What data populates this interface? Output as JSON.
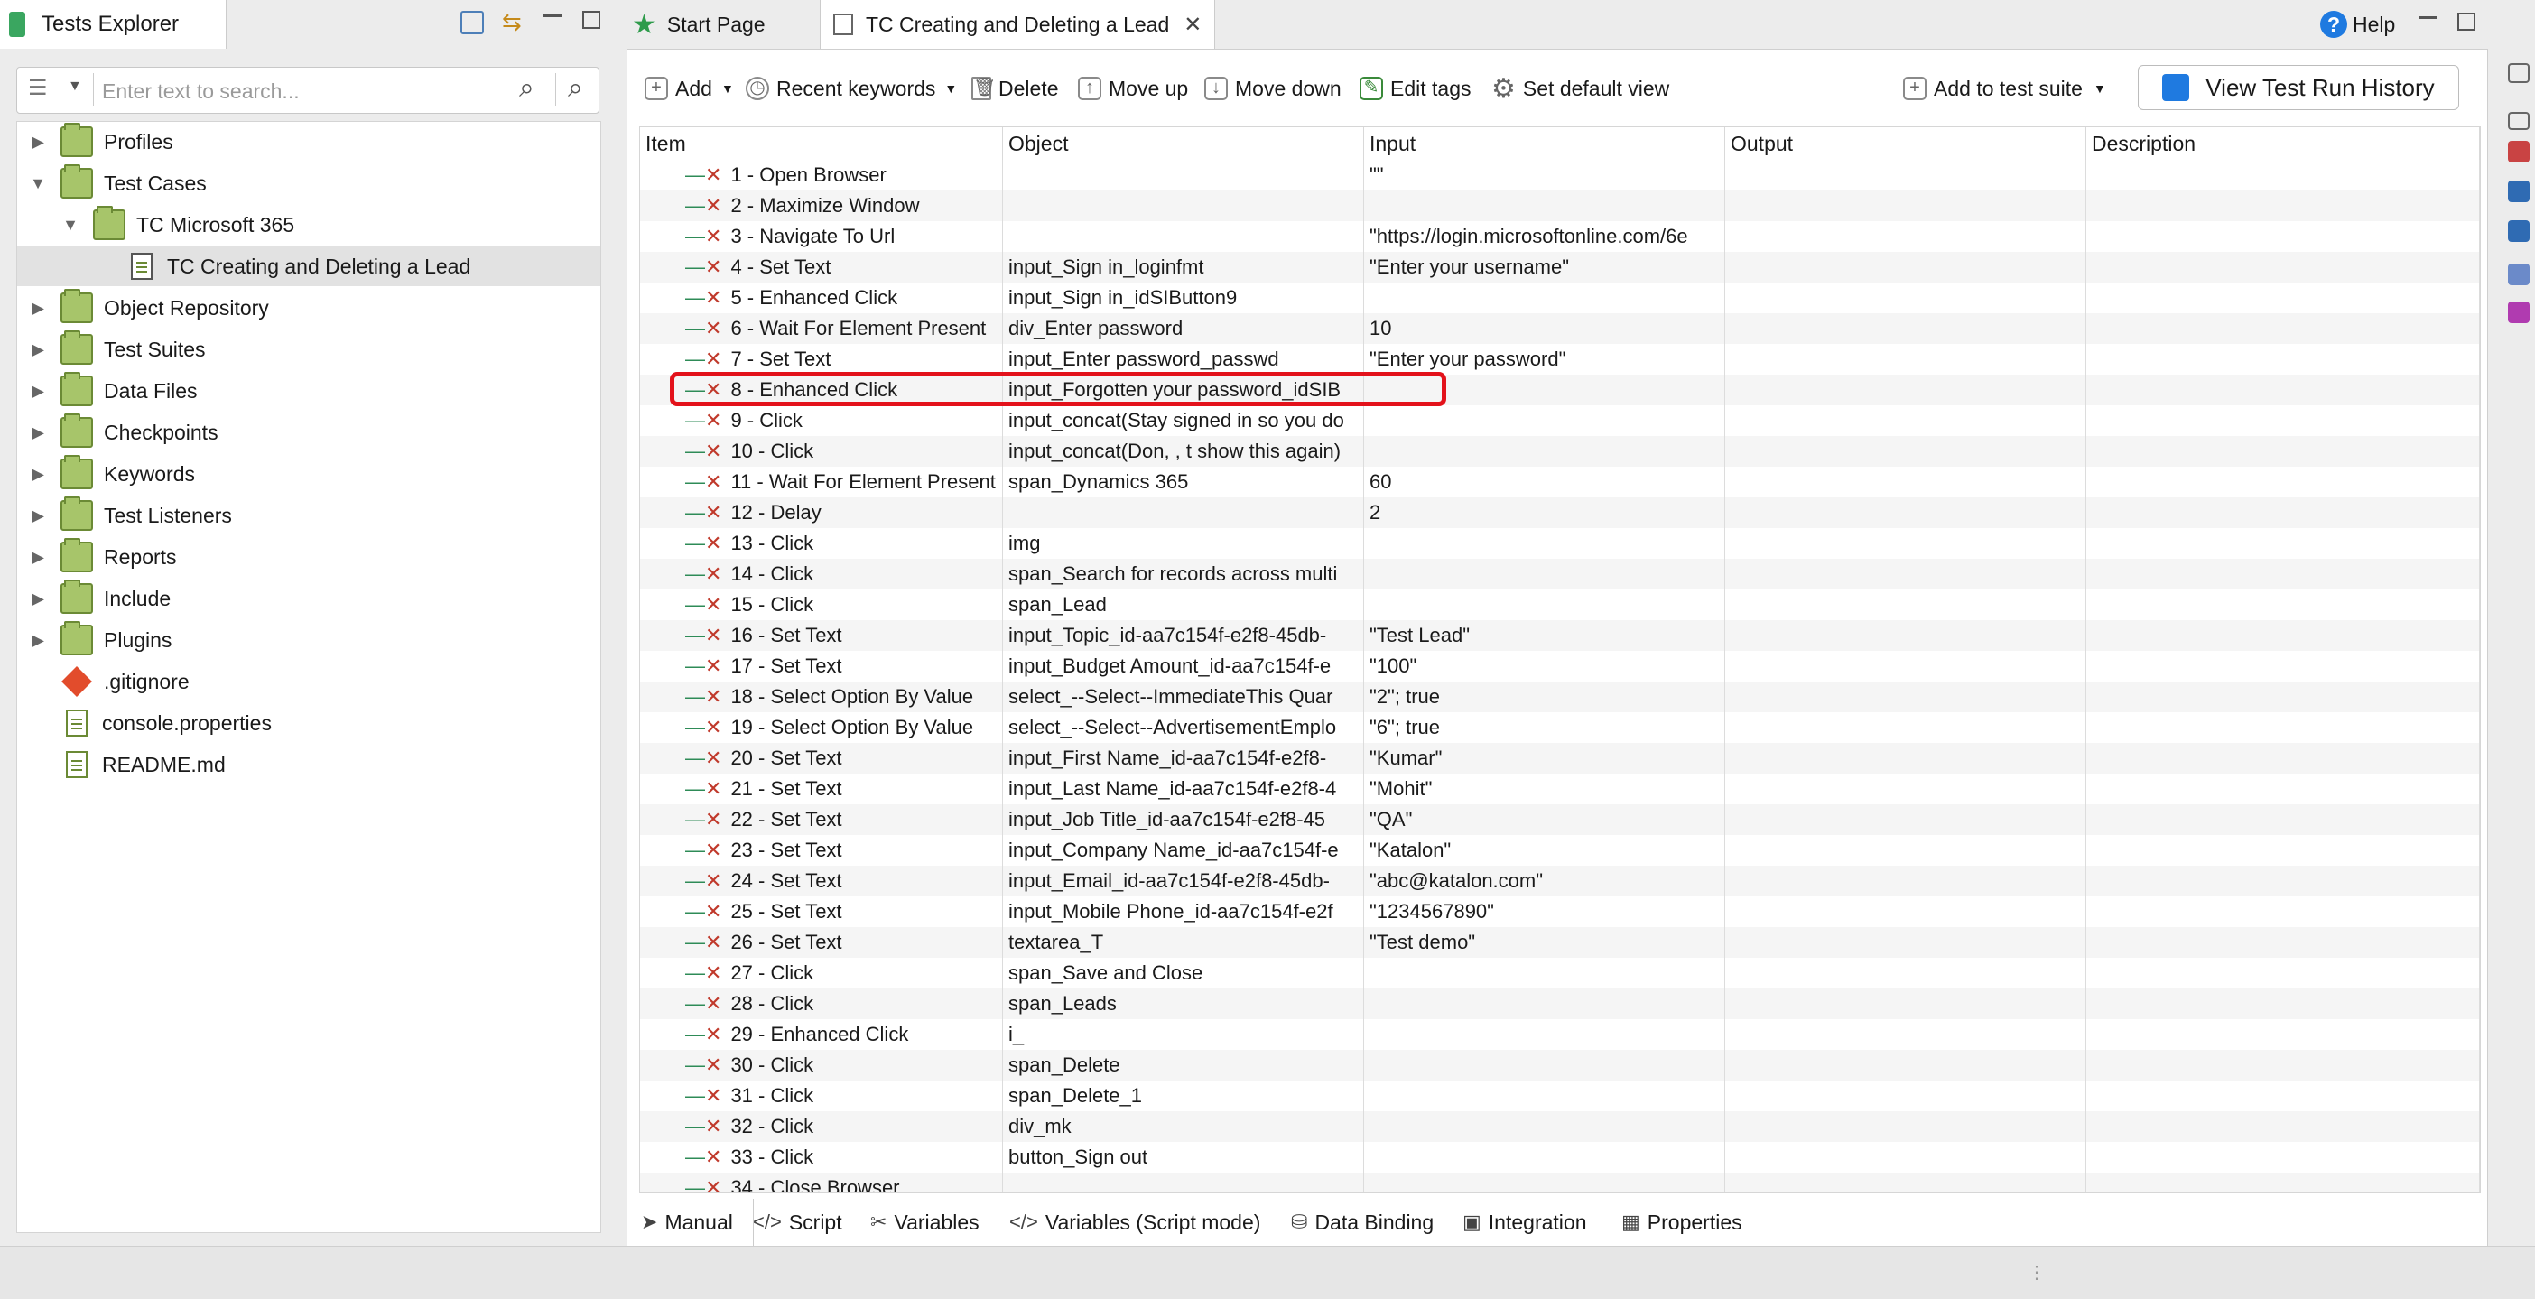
{
  "explorer": {
    "title": "Tests Explorer",
    "search_placeholder": "Enter text to search...",
    "tree": [
      {
        "label": "Profiles",
        "indent": 0,
        "twisty": "▶",
        "icon": "profiles-icon"
      },
      {
        "label": "Test Cases",
        "indent": 0,
        "twisty": "▼",
        "icon": "folder-icon"
      },
      {
        "label": "TC Microsoft 365",
        "indent": 1,
        "twisty": "▼",
        "icon": "folder-icon"
      },
      {
        "label": "TC Creating and Deleting a Lead",
        "indent": 2,
        "twisty": "",
        "icon": "testcase-icon",
        "selected": true
      },
      {
        "label": "Object Repository",
        "indent": 0,
        "twisty": "▶",
        "icon": "folder-icon"
      },
      {
        "label": "Test Suites",
        "indent": 0,
        "twisty": "▶",
        "icon": "folder-icon"
      },
      {
        "label": "Data Files",
        "indent": 0,
        "twisty": "▶",
        "icon": "folder-icon"
      },
      {
        "label": "Checkpoints",
        "indent": 0,
        "twisty": "▶",
        "icon": "folder-icon"
      },
      {
        "label": "Keywords",
        "indent": 0,
        "twisty": "▶",
        "icon": "folder-icon"
      },
      {
        "label": "Test Listeners",
        "indent": 0,
        "twisty": "▶",
        "icon": "folder-icon"
      },
      {
        "label": "Reports",
        "indent": 0,
        "twisty": "▶",
        "icon": "folder-icon"
      },
      {
        "label": "Include",
        "indent": 0,
        "twisty": "▶",
        "icon": "folder-icon"
      },
      {
        "label": "Plugins",
        "indent": 0,
        "twisty": "▶",
        "icon": "folder-icon"
      },
      {
        "label": ".gitignore",
        "indent": 0,
        "twisty": "",
        "icon": "git-icon"
      },
      {
        "label": "console.properties",
        "indent": 0,
        "twisty": "",
        "icon": "file-icon"
      },
      {
        "label": "README.md",
        "indent": 0,
        "twisty": "",
        "icon": "file-icon"
      }
    ]
  },
  "editor_tabs": {
    "start_page": "Start Page",
    "test_case": "TC Creating and Deleting a Lead",
    "help": "Help"
  },
  "toolbar": {
    "add": "Add",
    "recent_keywords": "Recent keywords",
    "delete": "Delete",
    "move_up": "Move up",
    "move_down": "Move down",
    "edit_tags": "Edit tags",
    "set_default_view": "Set default view",
    "add_to_suite": "Add to test suite",
    "view_history": "View Test Run History"
  },
  "table": {
    "headers": [
      "Item",
      "Object",
      "Input",
      "Output",
      "Description"
    ],
    "rows": [
      [
        "1 - Open Browser",
        "",
        "\"\""
      ],
      [
        "2 - Maximize Window",
        "",
        ""
      ],
      [
        "3 - Navigate To Url",
        "",
        "\"https://login.microsoftonline.com/6e"
      ],
      [
        "4 - Set Text",
        "input_Sign in_loginfmt",
        "\"Enter your username\""
      ],
      [
        "5 - Enhanced Click",
        "input_Sign in_idSIButton9",
        ""
      ],
      [
        "6 - Wait For Element Present",
        "div_Enter password",
        "10"
      ],
      [
        "7 - Set Text",
        "input_Enter password_passwd",
        "\"Enter your password\""
      ],
      [
        "8 - Enhanced Click",
        "input_Forgotten your password_idSIB",
        ""
      ],
      [
        "9 - Click",
        "input_concat(Stay signed in so you do",
        ""
      ],
      [
        "10 - Click",
        "input_concat(Don, , t show this again)",
        ""
      ],
      [
        "11 - Wait For Element Present",
        "span_Dynamics 365",
        "60"
      ],
      [
        "12 - Delay",
        "",
        "2"
      ],
      [
        "13 - Click",
        "img",
        ""
      ],
      [
        "14 - Click",
        "span_Search for records across multi",
        ""
      ],
      [
        "15 - Click",
        "span_Lead",
        ""
      ],
      [
        "16 - Set Text",
        "input_Topic_id-aa7c154f-e2f8-45db-",
        "\"Test Lead\""
      ],
      [
        "17 - Set Text",
        "input_Budget Amount_id-aa7c154f-e",
        "\"100\""
      ],
      [
        "18 - Select Option By Value",
        "select_--Select--ImmediateThis Quar",
        "\"2\"; true"
      ],
      [
        "19 - Select Option By Value",
        "select_--Select--AdvertisementEmplo",
        "\"6\"; true"
      ],
      [
        "20 - Set Text",
        "input_First Name_id-aa7c154f-e2f8-",
        "\"Kumar\""
      ],
      [
        "21 - Set Text",
        "input_Last Name_id-aa7c154f-e2f8-4",
        "\"Mohit\""
      ],
      [
        "22 - Set Text",
        "input_Job Title_id-aa7c154f-e2f8-45",
        "\"QA\""
      ],
      [
        "23 - Set Text",
        "input_Company Name_id-aa7c154f-e",
        "\"Katalon\""
      ],
      [
        "24 - Set Text",
        "input_Email_id-aa7c154f-e2f8-45db-",
        "\"abc@katalon.com\""
      ],
      [
        "25 - Set Text",
        "input_Mobile Phone_id-aa7c154f-e2f",
        "\"1234567890\""
      ],
      [
        "26 - Set Text",
        "textarea_T",
        "\"Test demo\""
      ],
      [
        "27 - Click",
        "span_Save and Close",
        ""
      ],
      [
        "28 - Click",
        "span_Leads",
        ""
      ],
      [
        "29 - Enhanced Click",
        "i_",
        ""
      ],
      [
        "30 - Click",
        "span_Delete",
        ""
      ],
      [
        "31 - Click",
        "span_Delete_1",
        ""
      ],
      [
        "32 - Click",
        "div_mk",
        ""
      ],
      [
        "33 - Click",
        "button_Sign out",
        ""
      ],
      [
        "34 - Close Browser",
        "",
        ""
      ]
    ]
  },
  "bottom_tabs": [
    "Manual",
    "Script",
    "Variables",
    "Variables (Script mode)",
    "Data Binding",
    "Integration",
    "Properties"
  ],
  "colors": {
    "highlight": "#e3121b",
    "step_fail": "#c0392b",
    "accent_blue": "#1f7ae0"
  }
}
